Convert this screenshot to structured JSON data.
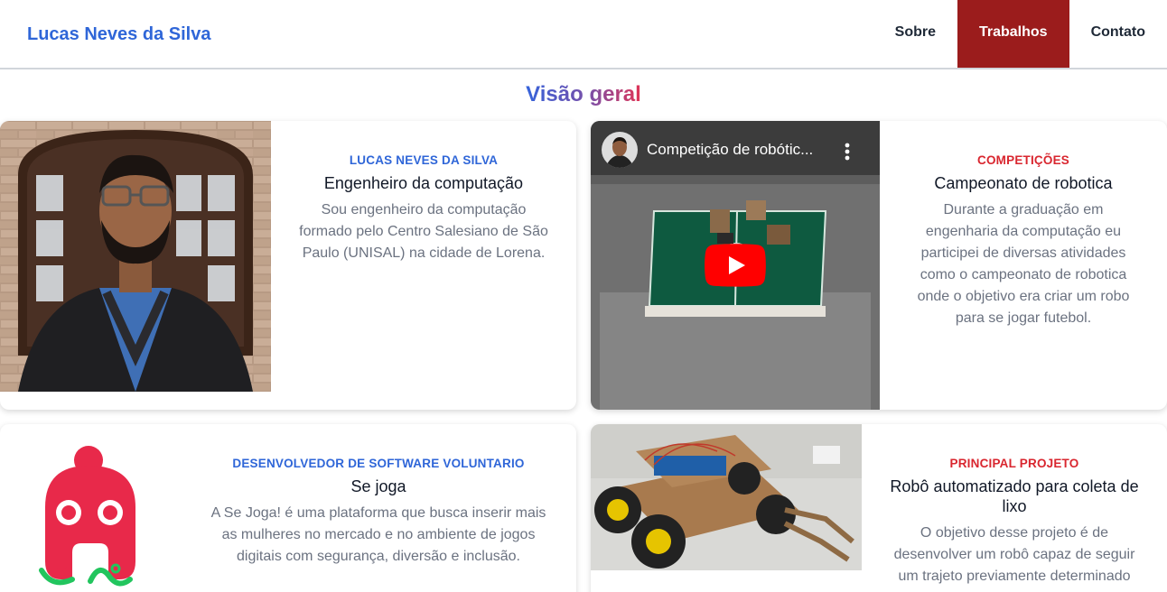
{
  "header": {
    "brand": "Lucas Neves da Silva",
    "nav": [
      {
        "label": "Sobre",
        "active": false
      },
      {
        "label": "Trabalhos",
        "active": true
      },
      {
        "label": "Contato",
        "active": false
      }
    ]
  },
  "page": {
    "title": "Visão geral"
  },
  "cards": [
    {
      "kicker": "LUCAS NEVES DA SILVA",
      "title": "Engenheiro da computação",
      "text": "Sou engenheiro da computação formado pelo Centro Salesiano de São Paulo (UNISAL) na cidade de Lorena."
    },
    {
      "kicker": "COMPETIÇÕES",
      "title": "Campeonato de robotica",
      "text": "Durante a graduação em engenharia da computação eu participei de diversas atividades como o campeonato de robotica onde o objetivo era criar um robo para se jogar futebol.",
      "video_title": "Competição de robótic..."
    },
    {
      "kicker": "DESENVOLVEDOR DE SOFTWARE VOLUNTARIO",
      "title": "Se joga",
      "text": "A Se Joga! é uma plataforma que busca inserir mais as mulheres no mercado e no ambiente de jogos digitais com segurança, diversão e inclusão."
    },
    {
      "kicker": "PRINCIPAL PROJETO",
      "title": "Robô automatizado para coleta de lixo",
      "text": "O objetivo desse projeto é de desenvolver um robô capaz de seguir um trajeto previamente determinado"
    }
  ],
  "colors": {
    "brand_blue": "#2f66d8",
    "accent_red": "#9b1c1c",
    "kicker_red": "#d9262f",
    "sejoga_pink": "#e8294a",
    "sejoga_green": "#22c55e"
  }
}
